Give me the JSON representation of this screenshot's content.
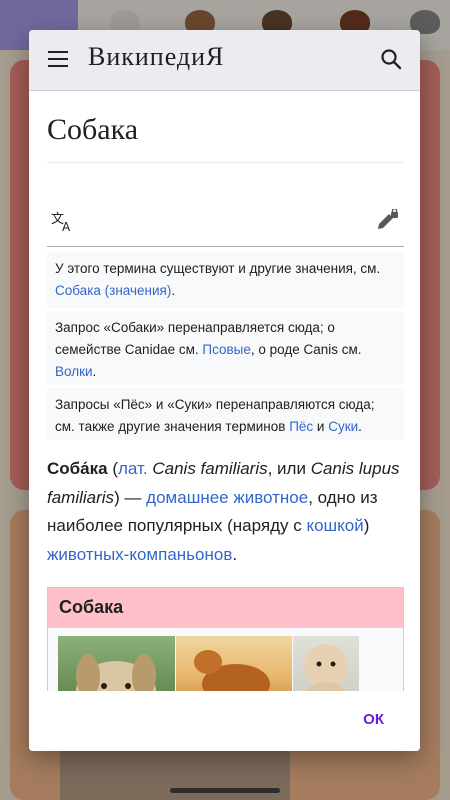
{
  "wiki": {
    "logo": "ВикипедиЯ",
    "title": "Собака",
    "hatnotes": {
      "h1": {
        "t1": "У этого термина существуют и другие значения, см. ",
        "l1": "Собака (значения)",
        "t2": "."
      },
      "h2": {
        "t1": "Запрос «Собаки» перенаправляется сюда; о семействе Canidae см. ",
        "l1": "Псовые",
        "t2": ", о роде Canis см. ",
        "l2": "Волки",
        "t3": "."
      },
      "h3": {
        "t1": "Запросы «Пёс» и «Суки» перенаправляются сюда; см. также другие значения терминов ",
        "l1": "Пёс",
        "t2": " и ",
        "l2": "Суки",
        "t3": "."
      }
    },
    "intro": {
      "term": "Соба́ка",
      "p1": " (",
      "lat": "лат.",
      "sp1": " ",
      "latin1": "Canis familiaris",
      "p2": ", или ",
      "latin2": "Canis lupus familiaris",
      "p3": ") — ",
      "link1": "домашнее животное",
      "p4": ", одно из наиболее популярных (наряду с ",
      "link2": "кошкой",
      "p5": ") ",
      "link3": "животных-компаньонов",
      "p6": "."
    },
    "infobox": {
      "title": "Собака"
    }
  },
  "dialog": {
    "ok_label": "ОК"
  },
  "colors": {
    "link": "#3366cc",
    "accent": "#6a1fd6",
    "infobox_header": "#ffc0cb"
  }
}
